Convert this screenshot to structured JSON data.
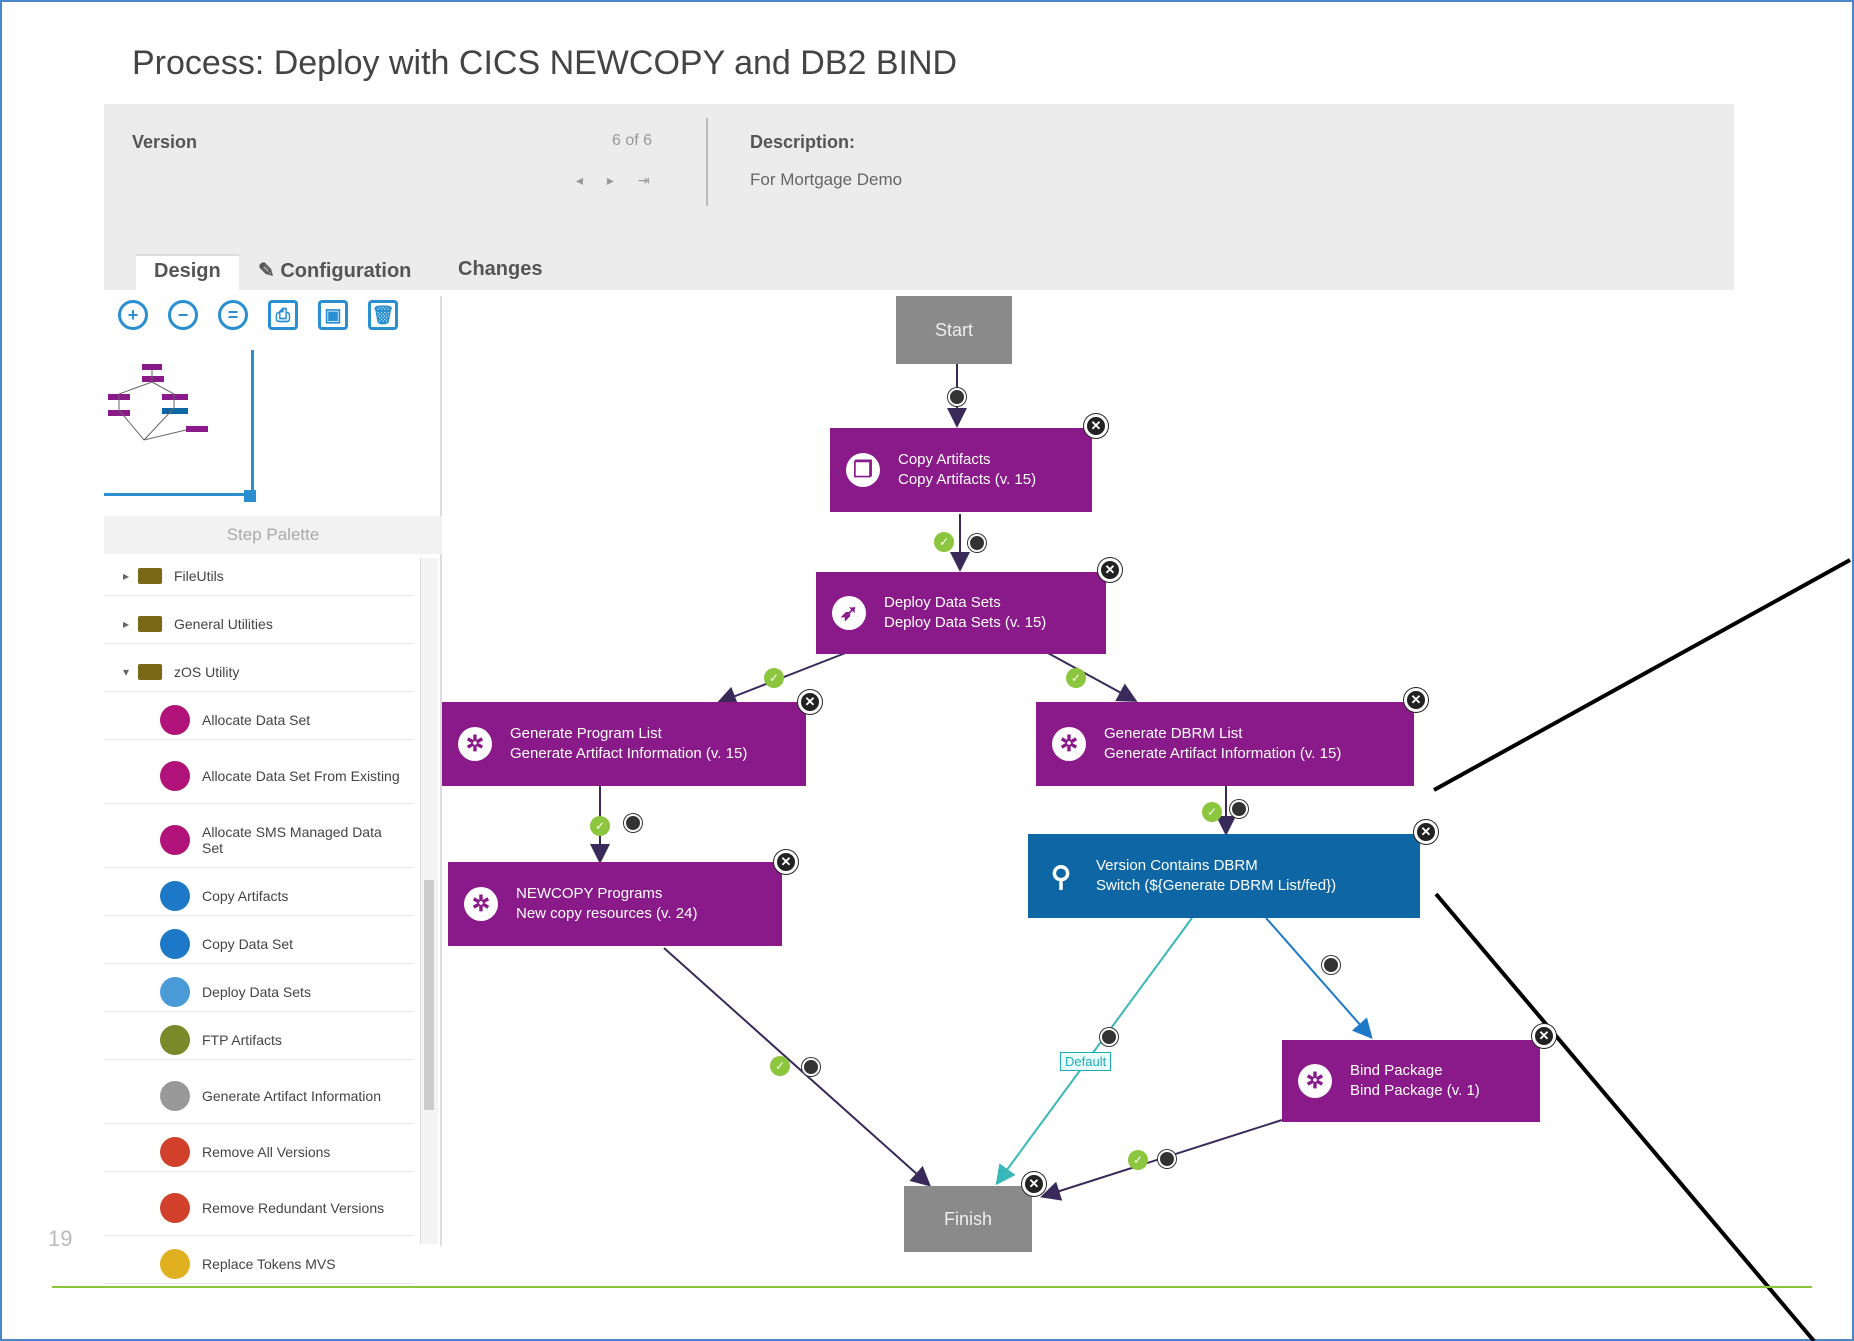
{
  "page": {
    "title": "Process: Deploy with CICS NEWCOPY and DB2 BIND",
    "version_label": "Version",
    "version_count": "6 of 6",
    "version_nav": "◂ ▸ ⇥",
    "description_label": "Description:",
    "description_value": "For Mortgage Demo",
    "page_number": "19"
  },
  "tabs": [
    {
      "label": "Design"
    },
    {
      "label": "✎ Configuration"
    },
    {
      "label": "Changes"
    }
  ],
  "toolbar": [
    "zoom-in-icon",
    "zoom-out-icon",
    "zoom-fit-icon",
    "print-icon",
    "export-icon",
    "trash-icon"
  ],
  "palette": {
    "header": "Step Palette",
    "items": [
      {
        "label": "FileUtils",
        "kind": "folder",
        "caret": "▸"
      },
      {
        "label": "General Utilities",
        "kind": "folder",
        "caret": "▸"
      },
      {
        "label": "zOS Utility",
        "kind": "folder",
        "caret": "▾"
      },
      {
        "label": "Allocate Data Set",
        "kind": "step",
        "color": "#b0127a"
      },
      {
        "label": "Allocate Data Set From Existing",
        "kind": "step",
        "color": "#b0127a"
      },
      {
        "label": "Allocate SMS Managed Data Set",
        "kind": "step",
        "color": "#b0127a"
      },
      {
        "label": "Copy Artifacts",
        "kind": "step",
        "color": "#1e78c8"
      },
      {
        "label": "Copy Data Set",
        "kind": "step",
        "color": "#1e78c8"
      },
      {
        "label": "Deploy Data Sets",
        "kind": "step",
        "color": "#4a9ad8"
      },
      {
        "label": "FTP Artifacts",
        "kind": "step",
        "color": "#7a8a2a"
      },
      {
        "label": "Generate Artifact Information",
        "kind": "step",
        "color": "#999999"
      },
      {
        "label": "Remove All Versions",
        "kind": "step",
        "color": "#d0402a"
      },
      {
        "label": "Remove Redundant Versions",
        "kind": "step",
        "color": "#d0402a"
      },
      {
        "label": "Replace Tokens MVS",
        "kind": "step",
        "color": "#e0b020"
      }
    ]
  },
  "nodes": {
    "start": {
      "label": "Start"
    },
    "copy": {
      "line1": "Copy Artifacts",
      "line2": "Copy Artifacts (v. 15)"
    },
    "deploy": {
      "line1": "Deploy Data Sets",
      "line2": "Deploy Data Sets (v. 15)"
    },
    "genprog": {
      "line1": "Generate Program List",
      "line2": "Generate Artifact Information (v. 15)"
    },
    "gendbrm": {
      "line1": "Generate DBRM List",
      "line2": "Generate Artifact Information (v. 15)"
    },
    "newcopy": {
      "line1": "NEWCOPY Programs",
      "line2": "New copy resources (v. 24)"
    },
    "switch": {
      "line1": "Version Contains DBRM",
      "line2": "Switch (${Generate DBRM List/fed})"
    },
    "bind": {
      "line1": "Bind Package",
      "line2": "Bind Package (v. 1)"
    },
    "finish": {
      "label": "Finish"
    },
    "default_label": "Default"
  },
  "colors": {
    "step": "#8a1a8a",
    "switch": "#0e66a4",
    "gray": "#8a8a8a",
    "success": "#8cc63f",
    "accent": "#2a8fd0"
  }
}
